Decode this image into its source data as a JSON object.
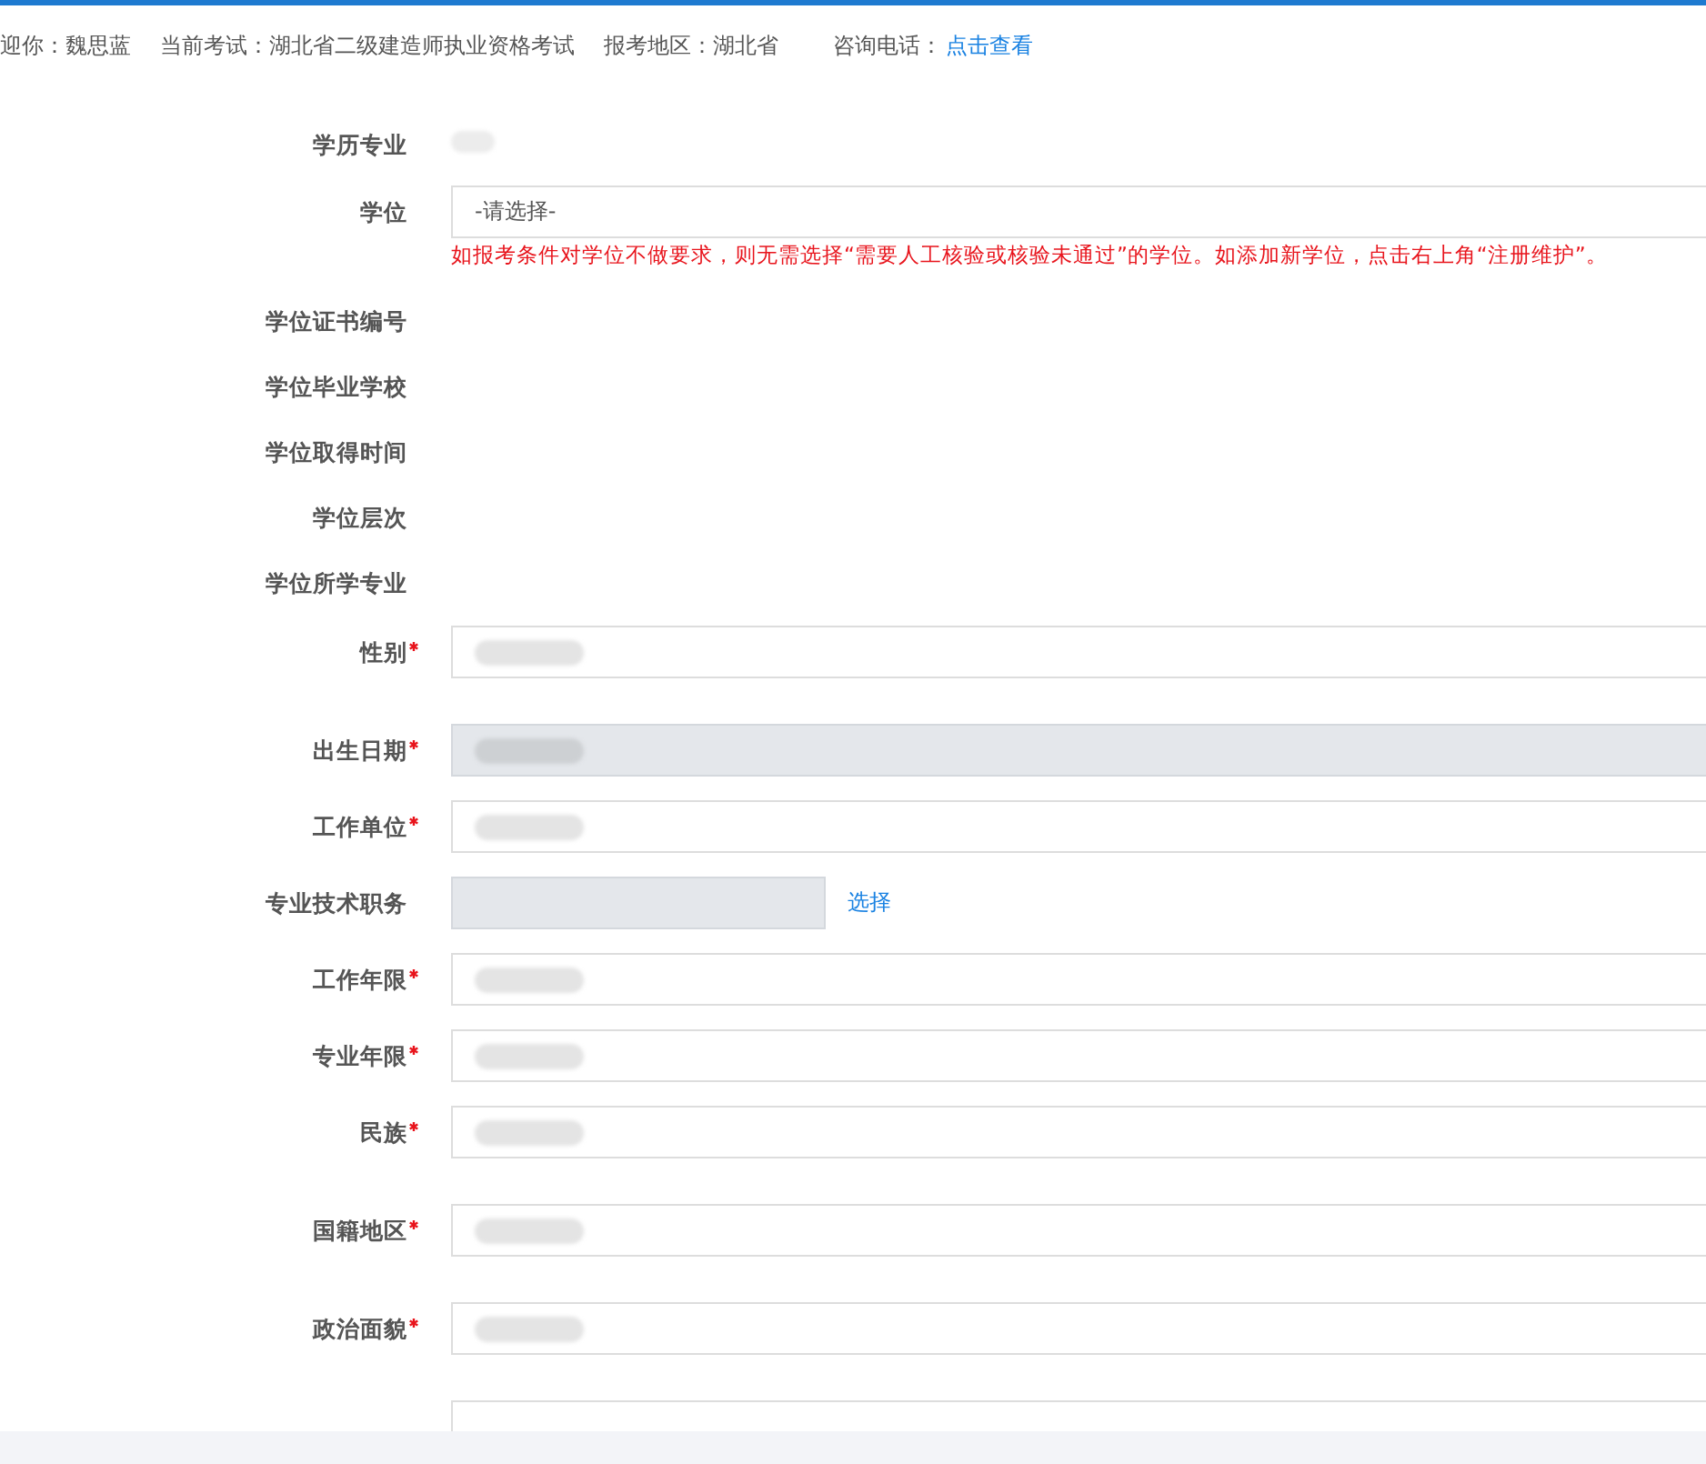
{
  "header": {
    "items": [
      {
        "text": "迎你：魏思蓝"
      },
      {
        "text": "当前考试：湖北省二级建造师执业资格考试"
      },
      {
        "text": "报考地区：湖北省"
      },
      {
        "text": "咨询电话：",
        "link": "点击查看"
      }
    ]
  },
  "form": {
    "rows": [
      {
        "label": "学历专业",
        "kind": "static",
        "redacted": true
      },
      {
        "label": "学位",
        "kind": "select",
        "placeholder": "-请选择-",
        "hint": "如报考条件对学位不做要求，则无需选择“需要人工核验或核验未通过”的学位。如添加新学位，点击右上角“注册维护”。"
      },
      {
        "label": "学位证书编号",
        "kind": "static"
      },
      {
        "label": "学位毕业学校",
        "kind": "static"
      },
      {
        "label": "学位取得时间",
        "kind": "static"
      },
      {
        "label": "学位层次",
        "kind": "static"
      },
      {
        "label": "学位所学专业",
        "kind": "static"
      },
      {
        "label": "性别",
        "kind": "input",
        "disabled": false,
        "redacted": true,
        "required": true
      },
      {
        "label": "出生日期",
        "kind": "input",
        "disabled": true,
        "redacted": true,
        "required": true
      },
      {
        "label": "工作单位",
        "kind": "input",
        "disabled": false,
        "redacted": true,
        "required": true
      },
      {
        "label": "专业技术职务",
        "kind": "picker",
        "disabled": true,
        "link": "选择"
      },
      {
        "label": "工作年限",
        "kind": "input",
        "disabled": false,
        "redacted": true,
        "required": true
      },
      {
        "label": "专业年限",
        "kind": "input",
        "disabled": false,
        "redacted": true,
        "required": true
      },
      {
        "label": "民族",
        "kind": "input",
        "disabled": false,
        "redacted": true,
        "required": true
      },
      {
        "label": "国籍地区",
        "kind": "input",
        "disabled": false,
        "redacted": true,
        "required": true
      },
      {
        "label": "政治面貌",
        "kind": "input",
        "disabled": false,
        "redacted": true,
        "required": true
      },
      {
        "kind": "input",
        "disabled": false
      }
    ]
  }
}
